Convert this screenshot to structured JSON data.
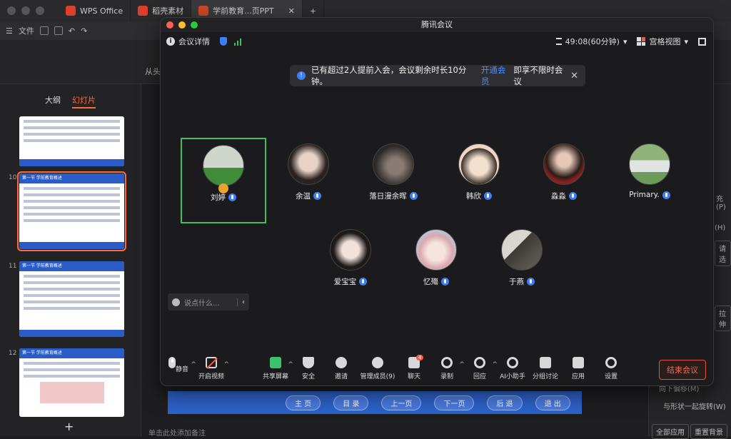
{
  "wps": {
    "tabs": [
      {
        "label": "WPS Office",
        "color": "#e03e2d"
      },
      {
        "label": "稻壳素材",
        "color": "#e03e2d"
      },
      {
        "label": "学前教育...页PPT",
        "color": "#d24726"
      }
    ],
    "file_menu": "文件",
    "from_start": "从头",
    "outline_tab": "大纲",
    "slides_tab": "幻灯片",
    "slide_numbers": [
      "10",
      "11",
      "12"
    ],
    "slide_titles": [
      "第一节  学前教育概述",
      "第一节  学前教育概述",
      "第一节  学前教育概述"
    ],
    "nav_buttons": [
      "主 页",
      "目 录",
      "上一页",
      "下一页",
      "后 退",
      "退 出"
    ],
    "notes_placeholder": "单击此处添加备注",
    "right_panel": {
      "fill_label": "充(P)",
      "h_label": "(H)",
      "select_btn": "请选",
      "stretch_btn": "拉伸",
      "zoom_label": "向下偏移(M)",
      "rotate_label": "与形状一起旋转(W)",
      "apply_all": "全部应用",
      "reset_bg": "重置背景"
    }
  },
  "meeting": {
    "window_title": "腾讯会议",
    "details_label": "会议详情",
    "timer": "49:08(60分钟)",
    "view_mode": "宫格视图",
    "notice": {
      "text": "已有超过2人提前入会，会议剩余时长10分钟。",
      "link": "开通会员",
      "suffix": "即享不限时会议"
    },
    "participants": [
      {
        "name": "刘婷",
        "speaking": true,
        "host": true
      },
      {
        "name": "余温"
      },
      {
        "name": "落日漫余晖"
      },
      {
        "name": "韩欣"
      },
      {
        "name": "淼淼"
      },
      {
        "name": "Primary."
      },
      {
        "name": "爱宝宝"
      },
      {
        "name": "忆殤"
      },
      {
        "name": "于燕"
      }
    ],
    "chat_placeholder": "说点什么...",
    "chat_unread": "4",
    "toolbar": [
      {
        "label": "静音",
        "icon": "mic-icon"
      },
      {
        "label": "开启视频",
        "icon": "camera-off-icon"
      },
      {
        "label": "共享屏幕",
        "icon": "share-screen-icon"
      },
      {
        "label": "安全",
        "icon": "shield-icon"
      },
      {
        "label": "邀请",
        "icon": "invite-icon"
      },
      {
        "label": "管理成员(9)",
        "icon": "members-icon"
      },
      {
        "label": "聊天",
        "icon": "chat-icon"
      },
      {
        "label": "录制",
        "icon": "record-icon"
      },
      {
        "label": "回应",
        "icon": "reaction-icon"
      },
      {
        "label": "AI小助手",
        "icon": "ai-assistant-icon"
      },
      {
        "label": "分组讨论",
        "icon": "breakout-icon"
      },
      {
        "label": "应用",
        "icon": "apps-icon"
      },
      {
        "label": "设置",
        "icon": "settings-icon"
      }
    ],
    "end_button": "结束会议"
  }
}
